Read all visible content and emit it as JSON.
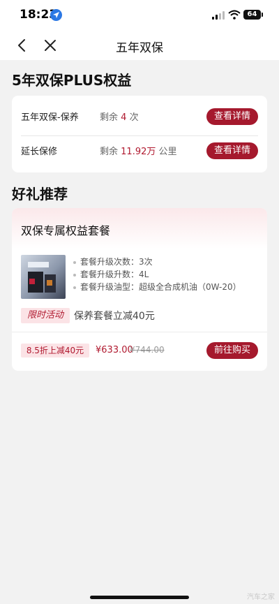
{
  "status_bar": {
    "time": "18:23",
    "battery": "64"
  },
  "nav": {
    "title": "五年双保"
  },
  "benefits": {
    "title": "5年双保PLUS权益",
    "rows": [
      {
        "label": "五年双保-保养",
        "remain_prefix": "剩余",
        "remain_value": "4",
        "remain_unit": "次",
        "button": "查看详情"
      },
      {
        "label": "延长保修",
        "remain_prefix": "剩余",
        "remain_value": "11.92万",
        "remain_unit": "公里",
        "button": "查看详情"
      }
    ]
  },
  "recommend": {
    "title": "好礼推荐",
    "package": {
      "title": "双保专属权益套餐",
      "features": [
        "套餐升级次数：3次",
        "套餐升级升数：4L",
        "套餐升级油型：超级全合成机油（0W-20）"
      ],
      "promo_badge": "限时活动",
      "promo_text": "保养套餐立减40元",
      "discount": "8.5折上减40元",
      "price": "¥633.00",
      "original_price": "¥744.00",
      "buy_button": "前往购买"
    }
  },
  "watermark": "汽车之家",
  "colors": {
    "accent": "#a5192d",
    "accent_light": "#fbe3e6",
    "background": "#f2f2f2"
  }
}
